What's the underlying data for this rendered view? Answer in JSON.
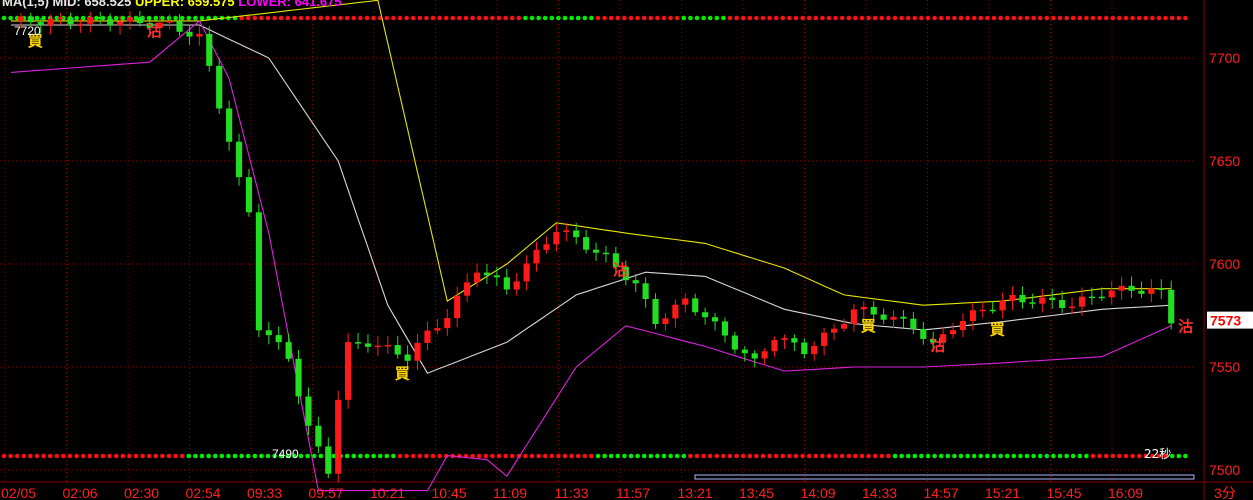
{
  "header": {
    "title_parts": [
      {
        "text": "MA(1,5) MID: 658.525 ",
        "color": "#e8e8e8"
      },
      {
        "text": "UPPER: 659.575 ",
        "color": "#ffff00"
      },
      {
        "text": "LOWER: 641.675",
        "color": "#ff00ff"
      }
    ]
  },
  "colors": {
    "background": "#000000",
    "grid": "#8b0000",
    "axis_text": "#ff2020",
    "time_text": "#ff2020",
    "up_candle": "#ff1a1a",
    "down_candle": "#22dd22",
    "mid_band": "#d8d8d8",
    "upper_band": "#e6e600",
    "lower_band": "#dd22dd",
    "buy_label": "#ffd700",
    "sell_label": "#ff3030",
    "price_tag_bg": "#ffffff",
    "price_tag_text": "#ff0000",
    "dot_green": "#00ee00",
    "dot_red": "#ff1010"
  },
  "chart_data": {
    "type": "candlestick",
    "y_axis": {
      "ticks": [
        7500,
        7550,
        7600,
        7650,
        7700
      ],
      "ylim": [
        7490,
        7730
      ],
      "grid": true
    },
    "x_axis": {
      "tick_labels": [
        "02/05",
        "02:06",
        "02:30",
        "02:54",
        "09:33",
        "09:57",
        "10:21",
        "10:45",
        "11:09",
        "11:33",
        "11:57",
        "13:21",
        "13:45",
        "14:09",
        "14:33",
        "14:57",
        "15:21",
        "15:45",
        "16:09",
        "3分"
      ],
      "grid": true
    },
    "last_price": "7573",
    "annotations": {
      "high_label": "7720",
      "low_label": "7490",
      "countdown": "22秒"
    },
    "price_key_points": [
      [
        0,
        7718
      ],
      [
        11,
        7718
      ],
      [
        16,
        7716
      ],
      [
        19,
        7710
      ],
      [
        20,
        7695
      ],
      [
        22,
        7660
      ],
      [
        23,
        7640
      ],
      [
        24,
        7625
      ],
      [
        25,
        7570
      ],
      [
        28,
        7555
      ],
      [
        30,
        7520
      ],
      [
        31,
        7510
      ],
      [
        32,
        7500
      ],
      [
        33,
        7535
      ],
      [
        34,
        7560
      ],
      [
        36,
        7562
      ],
      [
        40,
        7555
      ],
      [
        42,
        7566
      ],
      [
        44,
        7575
      ],
      [
        47,
        7598
      ],
      [
        50,
        7588
      ],
      [
        53,
        7605
      ],
      [
        55,
        7617
      ],
      [
        57,
        7612
      ],
      [
        60,
        7603
      ],
      [
        63,
        7590
      ],
      [
        65,
        7572
      ],
      [
        68,
        7582
      ],
      [
        70,
        7575
      ],
      [
        72,
        7565
      ],
      [
        75,
        7552
      ],
      [
        77,
        7565
      ],
      [
        80,
        7558
      ],
      [
        83,
        7568
      ],
      [
        85,
        7578
      ],
      [
        88,
        7575
      ],
      [
        91,
        7570
      ],
      [
        93,
        7560
      ],
      [
        95,
        7570
      ],
      [
        98,
        7578
      ],
      [
        101,
        7583
      ],
      [
        104,
        7582
      ],
      [
        107,
        7580
      ],
      [
        110,
        7586
      ],
      [
        113,
        7588
      ],
      [
        116,
        7586
      ],
      [
        117,
        7573
      ]
    ],
    "bands": {
      "upper": [
        [
          0,
          7718
        ],
        [
          14,
          7718
        ],
        [
          19,
          7718
        ],
        [
          37,
          7728
        ],
        [
          44,
          7582
        ],
        [
          50,
          7600
        ],
        [
          55,
          7620
        ],
        [
          62,
          7615
        ],
        [
          70,
          7610
        ],
        [
          78,
          7598
        ],
        [
          84,
          7585
        ],
        [
          92,
          7580
        ],
        [
          100,
          7582
        ],
        [
          110,
          7588
        ],
        [
          117,
          7588
        ]
      ],
      "mid": [
        [
          0,
          7716
        ],
        [
          14,
          7716
        ],
        [
          19,
          7716
        ],
        [
          26,
          7700
        ],
        [
          33,
          7650
        ],
        [
          38,
          7580
        ],
        [
          42,
          7547
        ],
        [
          50,
          7562
        ],
        [
          57,
          7585
        ],
        [
          64,
          7596
        ],
        [
          70,
          7594
        ],
        [
          78,
          7578
        ],
        [
          85,
          7571
        ],
        [
          92,
          7568
        ],
        [
          100,
          7572
        ],
        [
          110,
          7578
        ],
        [
          117,
          7580
        ]
      ],
      "lower": [
        [
          0,
          7693
        ],
        [
          14,
          7698
        ],
        [
          19,
          7718
        ],
        [
          22,
          7690
        ],
        [
          26,
          7615
        ],
        [
          31,
          7490
        ],
        [
          42,
          7490
        ],
        [
          44,
          7507
        ],
        [
          48,
          7505
        ],
        [
          50,
          7497
        ],
        [
          57,
          7550
        ],
        [
          62,
          7570
        ],
        [
          70,
          7560
        ],
        [
          78,
          7548
        ],
        [
          85,
          7550
        ],
        [
          92,
          7550
        ],
        [
          100,
          7552
        ],
        [
          110,
          7555
        ],
        [
          117,
          7570
        ]
      ]
    },
    "signals": [
      {
        "index": 2,
        "label": "買",
        "kind": "buy"
      },
      {
        "index": 14,
        "label": "沽",
        "kind": "sell"
      },
      {
        "index": 39,
        "label": "買",
        "kind": "buy"
      },
      {
        "index": 61,
        "label": "沽",
        "kind": "sell"
      },
      {
        "index": 86,
        "label": "買",
        "kind": "buy"
      },
      {
        "index": 93,
        "label": "沽",
        "kind": "sell"
      },
      {
        "index": 99,
        "label": "買",
        "kind": "buy"
      },
      {
        "index": 118,
        "label": "沽",
        "kind": "sell"
      }
    ]
  }
}
